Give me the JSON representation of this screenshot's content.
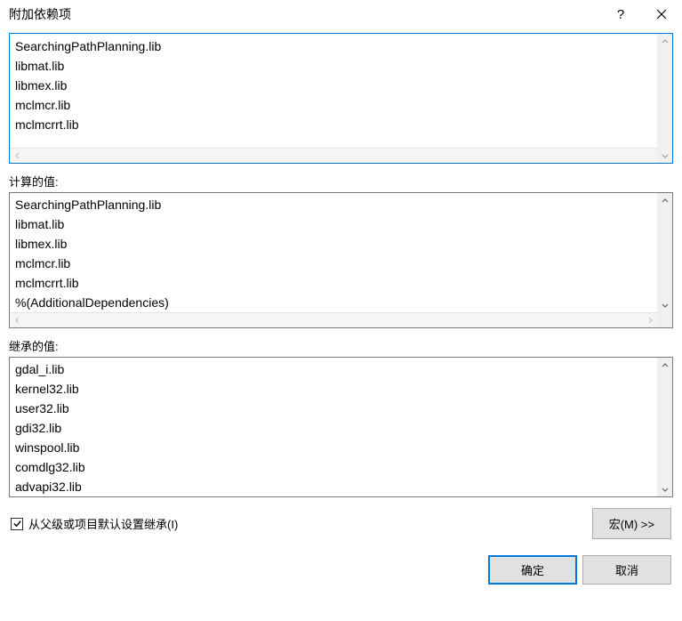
{
  "dialog": {
    "title": "附加依赖项",
    "help_symbol": "?",
    "input_lines": [
      "SearchingPathPlanning.lib",
      "libmat.lib",
      "libmex.lib",
      "mclmcr.lib",
      "mclmcrrt.lib"
    ],
    "computed_label": "计算的值:",
    "computed_lines": [
      "SearchingPathPlanning.lib",
      "libmat.lib",
      "libmex.lib",
      "mclmcr.lib",
      "mclmcrrt.lib",
      "%(AdditionalDependencies)"
    ],
    "inherited_label": "继承的值:",
    "inherited_lines": [
      "gdal_i.lib",
      "kernel32.lib",
      "user32.lib",
      "gdi32.lib",
      "winspool.lib",
      "comdlg32.lib",
      "advapi32.lib"
    ],
    "inherit_checkbox_label": "从父级或项目默认设置继承(I)",
    "inherit_checked": true,
    "macro_button": "宏(M) >>",
    "ok_button": "确定",
    "cancel_button": "取消"
  }
}
